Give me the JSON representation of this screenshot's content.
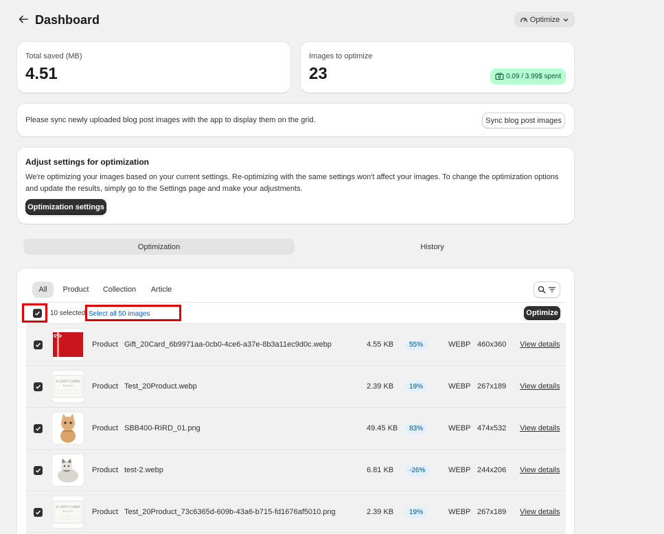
{
  "header": {
    "back_icon": "arrow-left-icon",
    "title": "Dashboard",
    "optimize_menu_label": "Optimize"
  },
  "stats": {
    "saved_label": "Total saved (MB)",
    "saved_value": "4.51",
    "images_label": "Images to optimize",
    "images_value": "23",
    "spent_badge": "0.09 / 3.99$ spent"
  },
  "sync": {
    "message": "Please sync newly uploaded blog post images with the app to display them on the grid.",
    "button_label": "Sync blog post images"
  },
  "settings_card": {
    "heading": "Adjust settings for optimization",
    "line1": "We're optimizing your images based on your current settings. Re-optimizing with the same settings won't affect your images. To change the optimization options",
    "line2": "and update the results, simply go to the Settings page and make your adjustments.",
    "button_label": "Optimization settings"
  },
  "main_tabs": [
    {
      "label": "Optimization",
      "active": true
    },
    {
      "label": "History",
      "active": false
    }
  ],
  "filters": [
    {
      "label": "All",
      "active": true
    },
    {
      "label": "Product"
    },
    {
      "label": "Collection"
    },
    {
      "label": "Article"
    }
  ],
  "selection": {
    "selected_text": "10 selected",
    "select_all_label": "Select all 50 images",
    "optimize_label": "Optimize"
  },
  "rows": [
    {
      "type": "Product",
      "name": "Gift_20Card_6b9971aa-0cb0-4ce6-a37e-8b3a11ec9d0c.webp",
      "size": "4.55 KB",
      "saving": "55%",
      "format": "WEBP",
      "dims": "460x360",
      "link": "View details",
      "thumb": "gift-card"
    },
    {
      "type": "Product",
      "name": "Test_20Product.webp",
      "size": "2.39 KB",
      "saving": "19%",
      "format": "WEBP",
      "dims": "267x189",
      "link": "View details",
      "thumb": "card"
    },
    {
      "type": "Product",
      "name": "SBB400-RIRD_01.png",
      "size": "49.45 KB",
      "saving": "83%",
      "format": "WEBP",
      "dims": "474x532",
      "link": "View details",
      "thumb": "kitten"
    },
    {
      "type": "Product",
      "name": "test-2.webp",
      "size": "6.81 KB",
      "saving": "-26%",
      "format": "WEBP",
      "dims": "244x206",
      "link": "View details",
      "thumb": "cat"
    },
    {
      "type": "Product",
      "name": "Test_20Product_73c6365d-609b-43a6-b715-fd1676af5010.png",
      "size": "2.39 KB",
      "saving": "19%",
      "format": "WEBP",
      "dims": "267x189",
      "link": "View details",
      "thumb": "card"
    }
  ],
  "colors": {
    "badge_green": "#b4fed2",
    "highlight_red": "#e00000",
    "link_blue": "#005bd3",
    "dark_button": "#303030"
  }
}
